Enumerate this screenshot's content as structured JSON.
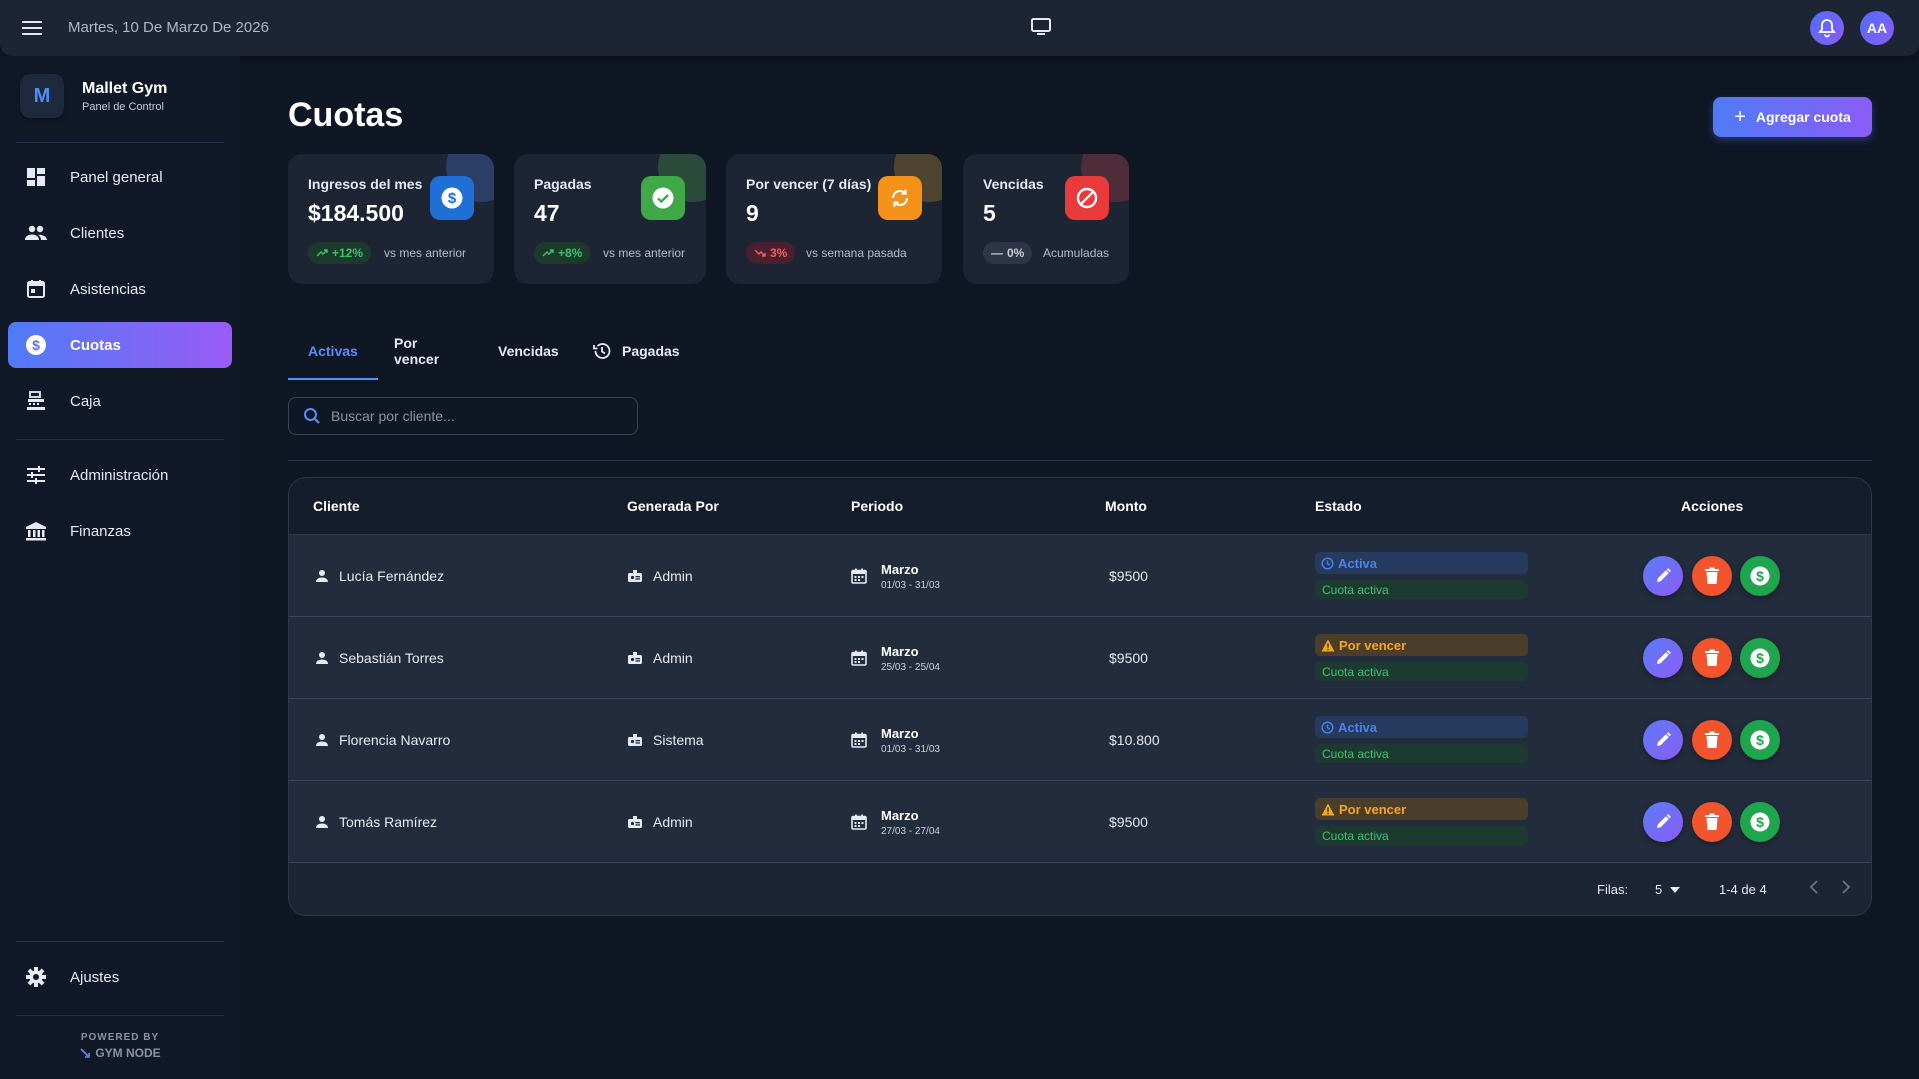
{
  "topbar": {
    "date": "Martes, 10 De Marzo De 2026",
    "avatar_initials": "AA"
  },
  "brand": {
    "logo_letter": "M",
    "name": "Mallet Gym",
    "subtitle": "Panel de Control"
  },
  "sidebar": {
    "items": [
      {
        "label": "Panel general",
        "icon": "dashboard-icon"
      },
      {
        "label": "Clientes",
        "icon": "people-icon"
      },
      {
        "label": "Asistencias",
        "icon": "calendar-icon"
      },
      {
        "label": "Cuotas",
        "icon": "dollar-icon",
        "active": true
      },
      {
        "label": "Caja",
        "icon": "cash-register-icon"
      },
      {
        "label": "Administración",
        "icon": "sliders-icon"
      },
      {
        "label": "Finanzas",
        "icon": "bank-icon"
      }
    ],
    "settings_label": "Ajustes",
    "powered_by": "POWERED BY",
    "powered_name": "GYM NODE"
  },
  "page": {
    "title": "Cuotas",
    "add_button": "Agregar cuota"
  },
  "stats": [
    {
      "label": "Ingresos del mes",
      "value": "$184.500",
      "badge": "+12%",
      "note": "vs mes anterior",
      "color": "#1f6fd6"
    },
    {
      "label": "Pagadas",
      "value": "47",
      "badge": "+8%",
      "note": "vs mes anterior",
      "color": "#3fa847"
    },
    {
      "label": "Por vencer (7 días)",
      "value": "9",
      "badge": "3%",
      "note": "vs semana pasada",
      "color": "#f5921a"
    },
    {
      "label": "Vencidas",
      "value": "5",
      "badge": "0%",
      "note": "Acumuladas",
      "color": "#e83a3a"
    }
  ],
  "tabs": [
    "Activas",
    "Por vencer",
    "Vencidas",
    "Pagadas"
  ],
  "search": {
    "placeholder": "Buscar por cliente..."
  },
  "table": {
    "headers": {
      "cliente": "Cliente",
      "generada": "Generada Por",
      "periodo": "Periodo",
      "monto": "Monto",
      "estado": "Estado",
      "acciones": "Acciones"
    },
    "currency_symbol": "$",
    "rows": [
      {
        "cliente": "Lucía Fernández",
        "generada": "Admin",
        "periodo": "Marzo",
        "rango": "01/03 - 31/03",
        "monto": "$9500",
        "estado": "Activa",
        "estado_tipo": "activa",
        "subestado": "Cuota activa"
      },
      {
        "cliente": "Sebastián Torres",
        "generada": "Admin",
        "periodo": "Marzo",
        "rango": "25/03 - 25/04",
        "monto": "$9500",
        "estado": "Por vencer",
        "estado_tipo": "por-vencer",
        "subestado": "Cuota activa"
      },
      {
        "cliente": "Florencia Navarro",
        "generada": "Sistema",
        "periodo": "Marzo",
        "rango": "01/03 - 31/03",
        "monto": "$10.800",
        "estado": "Activa",
        "estado_tipo": "activa",
        "subestado": "Cuota activa"
      },
      {
        "cliente": "Tomás Ramírez",
        "generada": "Admin",
        "periodo": "Marzo",
        "rango": "27/03 - 27/04",
        "monto": "$9500",
        "estado": "Por vencer",
        "estado_tipo": "por-vencer",
        "subestado": "Cuota activa"
      }
    ],
    "footer": {
      "rows_label": "Filas:",
      "rows_value": "5",
      "range": "1-4 de 4"
    }
  }
}
